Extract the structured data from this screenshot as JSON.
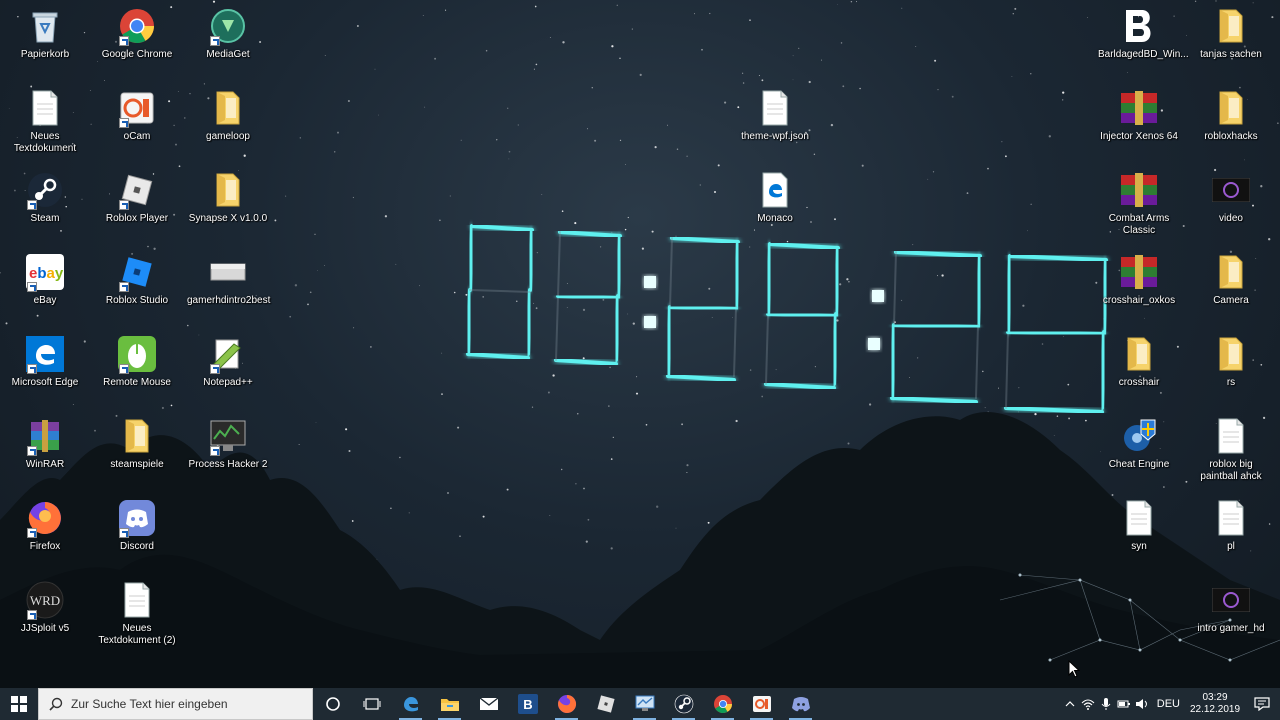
{
  "desktop": {
    "icons": [
      {
        "id": "papierkorb",
        "label": "Papierkorb",
        "icon": "recycle-bin-icon"
      },
      {
        "id": "google-chrome",
        "label": "Google Chrome",
        "icon": "chrome-icon"
      },
      {
        "id": "mediaget",
        "label": "MediaGet",
        "icon": "mediaget-icon"
      },
      {
        "id": "neues-textdokument",
        "label": "Neues Textdokument",
        "icon": "text-document-icon"
      },
      {
        "id": "ocam",
        "label": "oCam",
        "icon": "ocam-icon"
      },
      {
        "id": "gameloop",
        "label": "gameloop",
        "icon": "folder-icon"
      },
      {
        "id": "steam",
        "label": "Steam",
        "icon": "steam-icon"
      },
      {
        "id": "roblox-player",
        "label": "Roblox Player",
        "icon": "roblox-icon"
      },
      {
        "id": "synapse-x",
        "label": "Synapse X v1.0.0",
        "icon": "folder-icon"
      },
      {
        "id": "ebay",
        "label": "eBay",
        "icon": "ebay-icon"
      },
      {
        "id": "roblox-studio",
        "label": "Roblox Studio",
        "icon": "roblox-studio-icon"
      },
      {
        "id": "gamerhdintro2best",
        "label": "gamerhdintro2best",
        "icon": "image-file-icon"
      },
      {
        "id": "microsoft-edge",
        "label": "Microsoft Edge",
        "icon": "edge-icon"
      },
      {
        "id": "remote-mouse",
        "label": "Remote Mouse",
        "icon": "remote-mouse-icon"
      },
      {
        "id": "notepad-plus",
        "label": "Notepad++",
        "icon": "notepad-plus-icon"
      },
      {
        "id": "winrar",
        "label": "WinRAR",
        "icon": "winrar-icon"
      },
      {
        "id": "steamspiele",
        "label": "steamspiele",
        "icon": "folder-icon"
      },
      {
        "id": "process-hacker",
        "label": "Process Hacker 2",
        "icon": "process-hacker-icon"
      },
      {
        "id": "firefox",
        "label": "Firefox",
        "icon": "firefox-icon"
      },
      {
        "id": "discord",
        "label": "Discord",
        "icon": "discord-icon"
      },
      {
        "id": "jjsploit",
        "label": "JJSploit v5",
        "icon": "jjsploit-icon"
      },
      {
        "id": "neues-textdokument-2",
        "label": "Neues Textdokument (2)",
        "icon": "text-document-icon"
      },
      {
        "id": "theme-wpf-json",
        "label": "theme-wpf.json",
        "icon": "text-document-icon"
      },
      {
        "id": "monaco",
        "label": "Monaco",
        "icon": "edge-file-icon"
      },
      {
        "id": "barlagedbd",
        "label": "BarldagedBD_Win...",
        "icon": "b-app-icon"
      },
      {
        "id": "tanjas-sachen",
        "label": "tanjas sachen",
        "icon": "folder-icon"
      },
      {
        "id": "injector-xenos",
        "label": "Injector Xenos 64",
        "icon": "winrar-archive-icon"
      },
      {
        "id": "robloxhacks",
        "label": "robloxhacks",
        "icon": "folder-icon"
      },
      {
        "id": "combat-arms",
        "label": "Combat Arms Classic",
        "icon": "winrar-archive-icon"
      },
      {
        "id": "video",
        "label": "video",
        "icon": "video-file-icon"
      },
      {
        "id": "crosshair-oxkos",
        "label": "crosshair_oxkos",
        "icon": "winrar-archive-icon"
      },
      {
        "id": "camera",
        "label": "Camera",
        "icon": "folder-icon"
      },
      {
        "id": "crosshair",
        "label": "crosshair",
        "icon": "folder-icon"
      },
      {
        "id": "rs",
        "label": "rs",
        "icon": "folder-icon"
      },
      {
        "id": "cheat-engine",
        "label": "Cheat Engine",
        "icon": "cheat-engine-icon"
      },
      {
        "id": "roblox-big-paintball",
        "label": "roblox big paintball ahck",
        "icon": "text-document-icon"
      },
      {
        "id": "syn",
        "label": "syn",
        "icon": "text-document-icon"
      },
      {
        "id": "pl",
        "label": "pl",
        "icon": "text-document-icon"
      },
      {
        "id": "intro-gamer-hd",
        "label": "intro gamer_hd",
        "icon": "video-file-icon"
      }
    ]
  },
  "wallpaper_clock": {
    "time": "03:29:29",
    "color": "#5ef0ef"
  },
  "taskbar": {
    "search_placeholder": "Zur Suche Text hier eingeben",
    "pinned": [
      {
        "id": "cortana",
        "icon": "cortana-icon"
      },
      {
        "id": "task-view",
        "icon": "task-view-icon"
      },
      {
        "id": "edge",
        "icon": "edge-icon"
      },
      {
        "id": "explorer",
        "icon": "file-explorer-icon"
      },
      {
        "id": "mail",
        "icon": "mail-icon"
      },
      {
        "id": "b-app",
        "icon": "b-app-icon"
      },
      {
        "id": "firefox",
        "icon": "firefox-icon"
      },
      {
        "id": "roblox",
        "icon": "roblox-icon"
      },
      {
        "id": "remote-desktop",
        "icon": "remote-desktop-icon"
      },
      {
        "id": "steam",
        "icon": "steam-icon"
      },
      {
        "id": "chrome",
        "icon": "chrome-icon"
      },
      {
        "id": "ocam",
        "icon": "ocam-icon"
      },
      {
        "id": "discord",
        "icon": "discord-icon"
      }
    ],
    "language": "DEU",
    "time": "03:29",
    "date": "22.12.2019"
  },
  "colors": {
    "taskbar_bg": "#1f2a33",
    "accent": "#7fb2e0",
    "clock_glow": "#5ef0ef"
  }
}
